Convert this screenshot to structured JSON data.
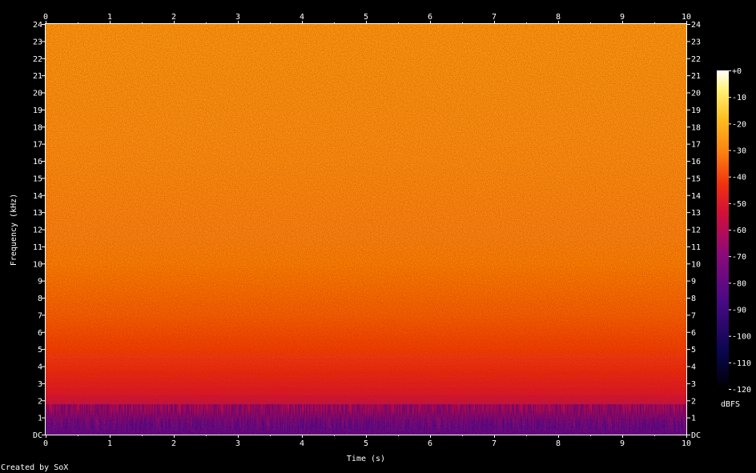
{
  "chart_data": {
    "type": "heatmap",
    "xlabel": "Time (s)",
    "ylabel": "Frequency (kHz)",
    "x_ticks": [
      "0",
      "1",
      "2",
      "3",
      "4",
      "5",
      "6",
      "7",
      "8",
      "9",
      "10"
    ],
    "y_ticks": [
      "DC",
      "1",
      "2",
      "3",
      "4",
      "5",
      "6",
      "7",
      "8",
      "9",
      "10",
      "11",
      "12",
      "13",
      "14",
      "15",
      "16",
      "17",
      "18",
      "19",
      "20",
      "21",
      "22",
      "23",
      "24"
    ],
    "xlim": [
      0,
      10
    ],
    "ylim": [
      0,
      24
    ],
    "colorbar": {
      "label": "dBFS",
      "ticks": [
        "+0",
        "-10",
        "-20",
        "-30",
        "-40",
        "-50",
        "-60",
        "-70",
        "-80",
        "-90",
        "-100",
        "-110",
        "-120"
      ],
      "range": [
        -120,
        0
      ]
    },
    "intensity_profile_dbfs": [
      {
        "freq_khz": 0.5,
        "level": -85
      },
      {
        "freq_khz": 1.5,
        "level": -60
      },
      {
        "freq_khz": 2.5,
        "level": -50
      },
      {
        "freq_khz": 3.5,
        "level": -45
      },
      {
        "freq_khz": 5,
        "level": -40
      },
      {
        "freq_khz": 7,
        "level": -35
      },
      {
        "freq_khz": 10,
        "level": -30
      },
      {
        "freq_khz": 16,
        "level": -27
      },
      {
        "freq_khz": 24,
        "level": -25
      }
    ],
    "grid": false
  },
  "footer": {
    "credit": "Created by SoX"
  }
}
